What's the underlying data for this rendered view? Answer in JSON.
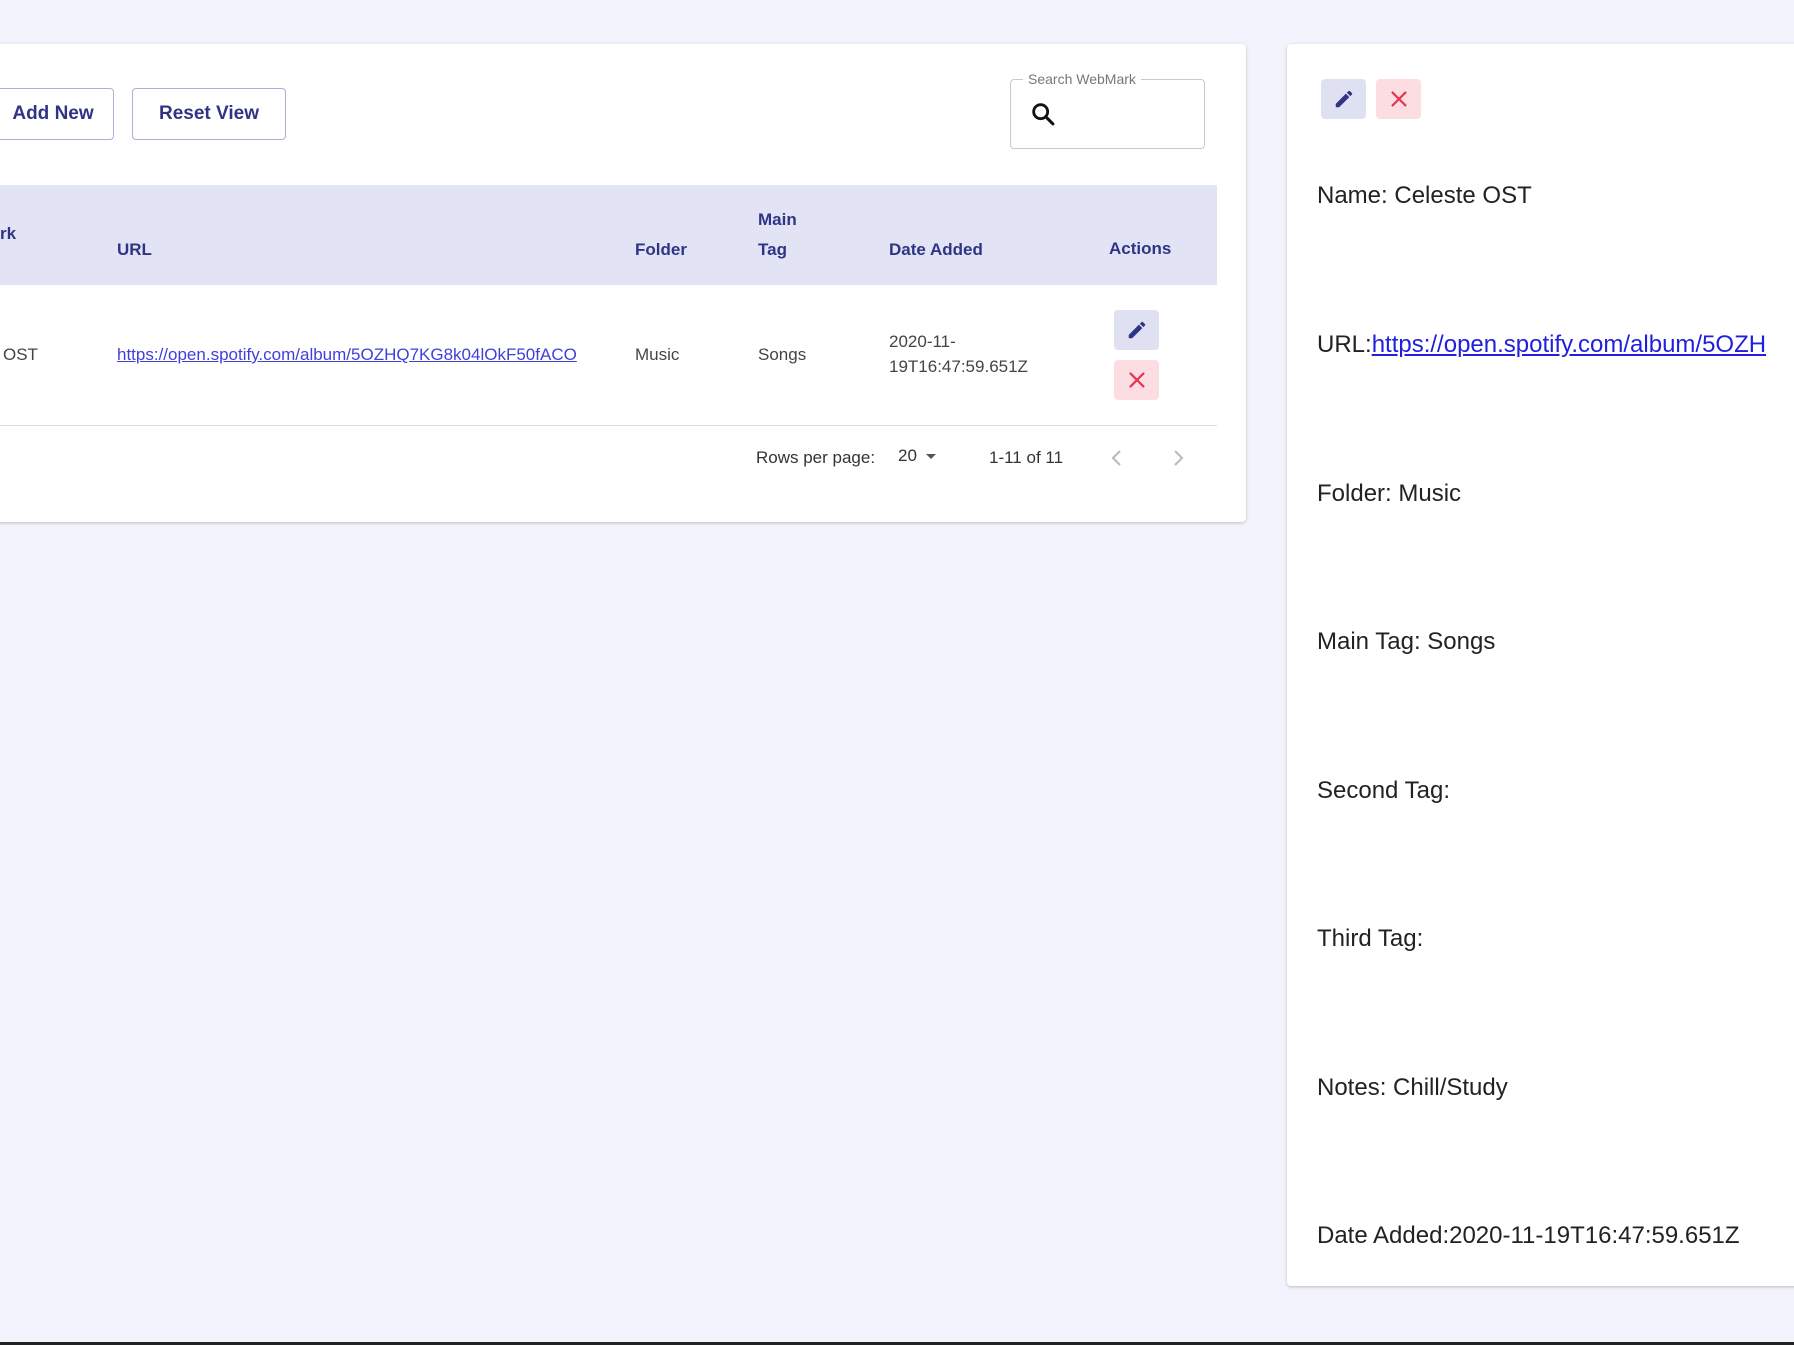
{
  "toolbar": {
    "add_new_label": "Add New",
    "reset_view_label": "Reset View"
  },
  "search": {
    "label": "Search WebMark",
    "value": ""
  },
  "table": {
    "headers": {
      "name_partial": "rk",
      "url": "URL",
      "folder": "Folder",
      "main_tag_line1": "Main",
      "main_tag_line2": "Tag",
      "date_added": "Date Added",
      "actions": "Actions"
    },
    "rows": [
      {
        "name_partial": "OST",
        "url": "https://open.spotify.com/album/5OZHQ7KG8k04lOkF50fACO",
        "folder": "Music",
        "main_tag": "Songs",
        "date_line1": "2020-11-",
        "date_line2": "19T16:47:59.651Z"
      }
    ]
  },
  "pagination": {
    "rows_per_page_label": "Rows per page:",
    "rows_per_page_value": "20",
    "range": "1-11 of 11"
  },
  "detail": {
    "name_label": "Name: ",
    "name_value": "Celeste OST",
    "url_label": "URL:",
    "url_value": "https://open.spotify.com/album/5OZH",
    "folder_label": "Folder: ",
    "folder_value": "Music",
    "main_tag_label": "Main Tag: ",
    "main_tag_value": "Songs",
    "second_tag_label": "Second Tag:",
    "third_tag_label": "Third Tag:",
    "notes_label": "Notes: ",
    "notes_value": "Chill/Study",
    "date_label": "Date Added:",
    "date_value": "2020-11-19T16:47:59.651Z"
  },
  "icons": {
    "edit": "pencil-icon",
    "delete": "close-icon",
    "search": "search-icon",
    "dropdown": "caret-down-icon",
    "prev": "chevron-left-icon",
    "next": "chevron-right-icon"
  },
  "colors": {
    "background": "#f2f3fc",
    "accent": "#2f3584",
    "header_bg": "#e2e4f5",
    "delete": "#e8344f",
    "link": "#3f3fdb"
  }
}
